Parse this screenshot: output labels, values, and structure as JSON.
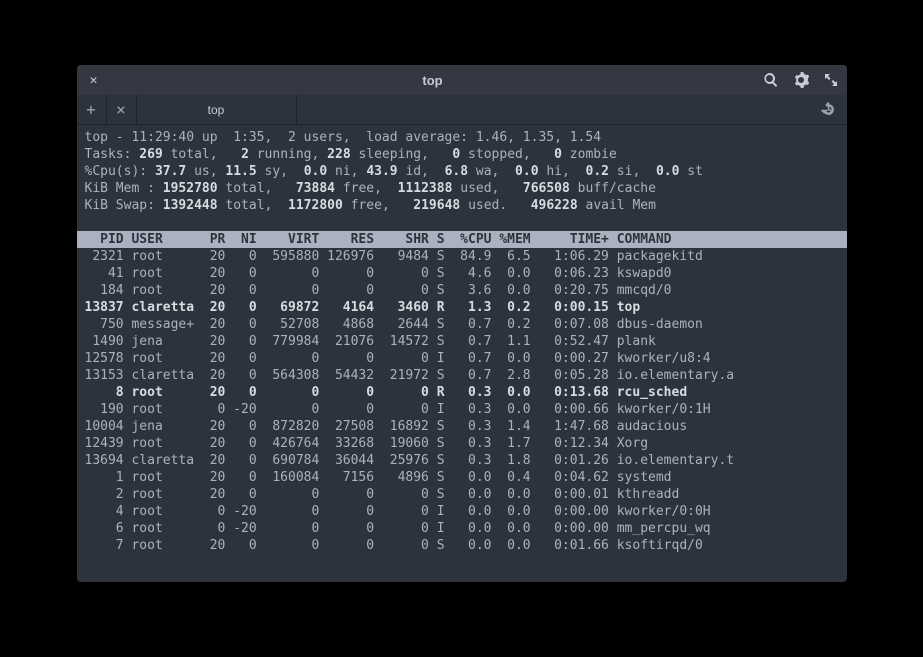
{
  "window": {
    "title": "top",
    "tab_label": "top"
  },
  "summary": {
    "line1_prefix": "top - 11:29:40 up  1:35,  2 users,  load average: 1.46, 1.35, 1.54",
    "tasks": {
      "label": "Tasks: ",
      "total": "269",
      "total_suf": " total,   ",
      "running": "2",
      "running_suf": " running, ",
      "sleeping": "228",
      "sleeping_suf": " sleeping,   ",
      "stopped": "0",
      "stopped_suf": " stopped,   ",
      "zombie": "0",
      "zombie_suf": " zombie"
    },
    "cpu": {
      "label": "%Cpu(s): ",
      "us": "37.7",
      "us_suf": " us, ",
      "sy": "11.5",
      "sy_suf": " sy,  ",
      "ni": "0.0",
      "ni_suf": " ni, ",
      "id": "43.9",
      "id_suf": " id,  ",
      "wa": "6.8",
      "wa_suf": " wa,  ",
      "hi": "0.0",
      "hi_suf": " hi,  ",
      "si": "0.2",
      "si_suf": " si,  ",
      "st": "0.0",
      "st_suf": " st"
    },
    "mem": {
      "label": "KiB Mem : ",
      "total": "1952780",
      "total_suf": " total,   ",
      "free": "73884",
      "free_suf": " free,  ",
      "used": "1112388",
      "used_suf": " used,   ",
      "buff": "766508",
      "buff_suf": " buff/cache"
    },
    "swap": {
      "label": "KiB Swap: ",
      "total": "1392448",
      "total_suf": " total,  ",
      "free": "1172800",
      "free_suf": " free,   ",
      "used": "219648",
      "used_suf": " used.   ",
      "avail": "496228",
      "avail_suf": " avail Mem"
    }
  },
  "columns": "  PID USER      PR  NI    VIRT    RES    SHR S  %CPU %MEM     TIME+ COMMAND                       ",
  "processes": [
    {
      "bold": false,
      "line": " 2321 root      20   0  595880 126976   9484 S  84.9  6.5   1:06.29 packagekitd"
    },
    {
      "bold": false,
      "line": "   41 root      20   0       0      0      0 S   4.6  0.0   0:06.23 kswapd0"
    },
    {
      "bold": false,
      "line": "  184 root      20   0       0      0      0 S   3.6  0.0   0:20.75 mmcqd/0"
    },
    {
      "bold": true,
      "line": "13837 claretta  20   0   69872   4164   3460 R   1.3  0.2   0:00.15 top"
    },
    {
      "bold": false,
      "line": "  750 message+  20   0   52708   4868   2644 S   0.7  0.2   0:07.08 dbus-daemon"
    },
    {
      "bold": false,
      "line": " 1490 jena      20   0  779984  21076  14572 S   0.7  1.1   0:52.47 plank"
    },
    {
      "bold": false,
      "line": "12578 root      20   0       0      0      0 I   0.7  0.0   0:00.27 kworker/u8:4"
    },
    {
      "bold": false,
      "line": "13153 claretta  20   0  564308  54432  21972 S   0.7  2.8   0:05.28 io.elementary.a"
    },
    {
      "bold": true,
      "line": "    8 root      20   0       0      0      0 R   0.3  0.0   0:13.68 rcu_sched"
    },
    {
      "bold": false,
      "line": "  190 root       0 -20       0      0      0 I   0.3  0.0   0:00.66 kworker/0:1H"
    },
    {
      "bold": false,
      "line": "10004 jena      20   0  872820  27508  16892 S   0.3  1.4   1:47.68 audacious"
    },
    {
      "bold": false,
      "line": "12439 root      20   0  426764  33268  19060 S   0.3  1.7   0:12.34 Xorg"
    },
    {
      "bold": false,
      "line": "13694 claretta  20   0  690784  36044  25976 S   0.3  1.8   0:01.26 io.elementary.t"
    },
    {
      "bold": false,
      "line": "    1 root      20   0  160084   7156   4896 S   0.0  0.4   0:04.62 systemd"
    },
    {
      "bold": false,
      "line": "    2 root      20   0       0      0      0 S   0.0  0.0   0:00.01 kthreadd"
    },
    {
      "bold": false,
      "line": "    4 root       0 -20       0      0      0 I   0.0  0.0   0:00.00 kworker/0:0H"
    },
    {
      "bold": false,
      "line": "    6 root       0 -20       0      0      0 I   0.0  0.0   0:00.00 mm_percpu_wq"
    },
    {
      "bold": false,
      "line": "    7 root      20   0       0      0      0 S   0.0  0.0   0:01.66 ksoftirqd/0"
    }
  ]
}
